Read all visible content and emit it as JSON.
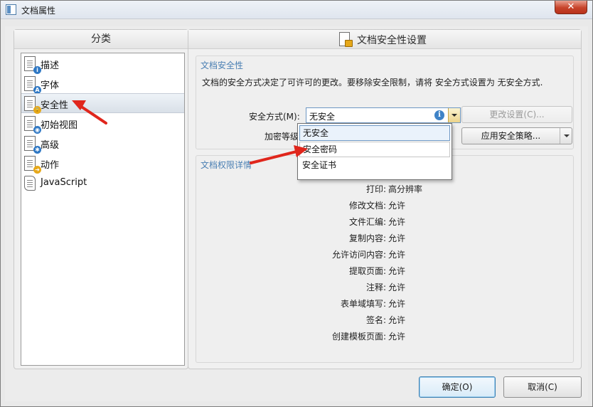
{
  "window": {
    "title": "文档属性",
    "close_label": "✕"
  },
  "left": {
    "header": "分类",
    "items": [
      {
        "label": "描述",
        "icon": "doc-info-icon",
        "badge": "i",
        "badge_color": "#2f78c4"
      },
      {
        "label": "字体",
        "icon": "doc-font-icon",
        "badge": "A",
        "badge_color": "#2f78c4"
      },
      {
        "label": "安全性",
        "icon": "doc-lock-icon",
        "badge": "🔒",
        "badge_color": "#e6a81a",
        "selected": true
      },
      {
        "label": "初始视图",
        "icon": "doc-view-icon",
        "badge": "◉",
        "badge_color": "#2f78c4"
      },
      {
        "label": "高级",
        "icon": "doc-gear-icon",
        "badge": "✱",
        "badge_color": "#2f78c4"
      },
      {
        "label": "动作",
        "icon": "doc-action-icon",
        "badge": "➜",
        "badge_color": "#e6a81a"
      },
      {
        "label": "JavaScript",
        "icon": "script-scroll-icon",
        "badge": "",
        "badge_color": "#ffffff"
      }
    ]
  },
  "right": {
    "header": "文档安全性设置",
    "security": {
      "title": "文档安全性",
      "description": "文档的安全方式决定了可许可的更改。要移除安全限制，请将 安全方式设置为 无安全方式.",
      "method_label": "安全方式(M):",
      "method_value": "无安全",
      "encryption_label": "加密等级:",
      "change_settings_label": "更改设置(C)...",
      "apply_policy_label": "应用安全策略..."
    },
    "dropdown_options": [
      "无安全",
      "安全密码",
      "安全证书"
    ],
    "permissions": {
      "title": "文档权限详情",
      "rows": [
        {
          "label": "打印:",
          "value": "高分辨率"
        },
        {
          "label": "修改文档:",
          "value": "允许"
        },
        {
          "label": "文件汇编:",
          "value": "允许"
        },
        {
          "label": "复制内容:",
          "value": "允许"
        },
        {
          "label": "允许访问内容:",
          "value": "允许"
        },
        {
          "label": "提取页面:",
          "value": "允许"
        },
        {
          "label": "注释:",
          "value": "允许"
        },
        {
          "label": "表单域填写:",
          "value": "允许"
        },
        {
          "label": "签名:",
          "value": "允许"
        },
        {
          "label": "创建模板页面:",
          "value": "允许"
        }
      ]
    }
  },
  "footer": {
    "ok_label": "确定(O)",
    "cancel_label": "取消(C)"
  },
  "colors": {
    "annotation_arrow": "#e0261c",
    "group_title": "#4a7fb3",
    "selection_border": "#6d97c3"
  }
}
